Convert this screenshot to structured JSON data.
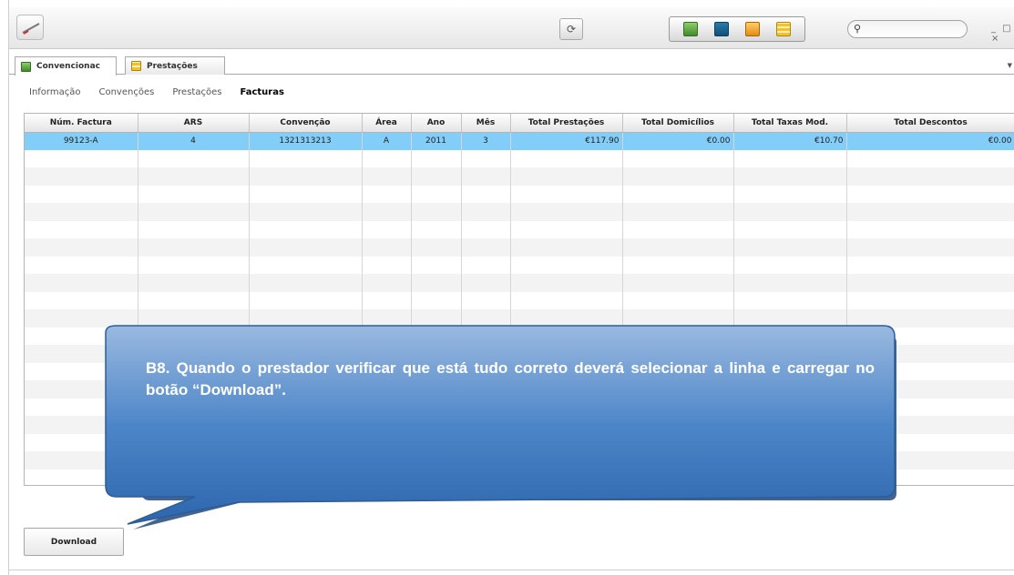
{
  "toolbar": {
    "refresh_icon": "refresh-icon",
    "icons": [
      "green-book-icon",
      "folder-icon",
      "orange-book-icon",
      "calculator-icon"
    ],
    "search": {
      "placeholder": "",
      "icon": "search-icon"
    },
    "window_controls": "_ □ ×"
  },
  "tabs": [
    {
      "label": "Convencionac",
      "icon": "green-book-icon",
      "active": true
    },
    {
      "label": "Prestações",
      "icon": "calculator-icon",
      "active": false
    }
  ],
  "subnav": {
    "items": [
      "Informação",
      "Convenções",
      "Prestações",
      "Facturas"
    ],
    "selected": "Facturas"
  },
  "table": {
    "columns": [
      "Núm. Factura",
      "ARS",
      "Convenção",
      "Área",
      "Ano",
      "Mês",
      "Total Prestações",
      "Total Domicílios",
      "Total Taxas Mod.",
      "Total Descontos"
    ],
    "rows": [
      [
        "99123-A",
        "4",
        "1321313213",
        "A",
        "2011",
        "3",
        "€117.90",
        "€0.00",
        "€10.70",
        "€0.00"
      ]
    ],
    "selected_row": 0,
    "selection_color": "#83cdf9"
  },
  "callout": {
    "text": "B8. Quando o prestador verificar que está tudo correto deverá selecionar a linha e carregar no botão “Download”.",
    "color": "#4e86c6"
  },
  "download_button": {
    "label": "Download"
  }
}
